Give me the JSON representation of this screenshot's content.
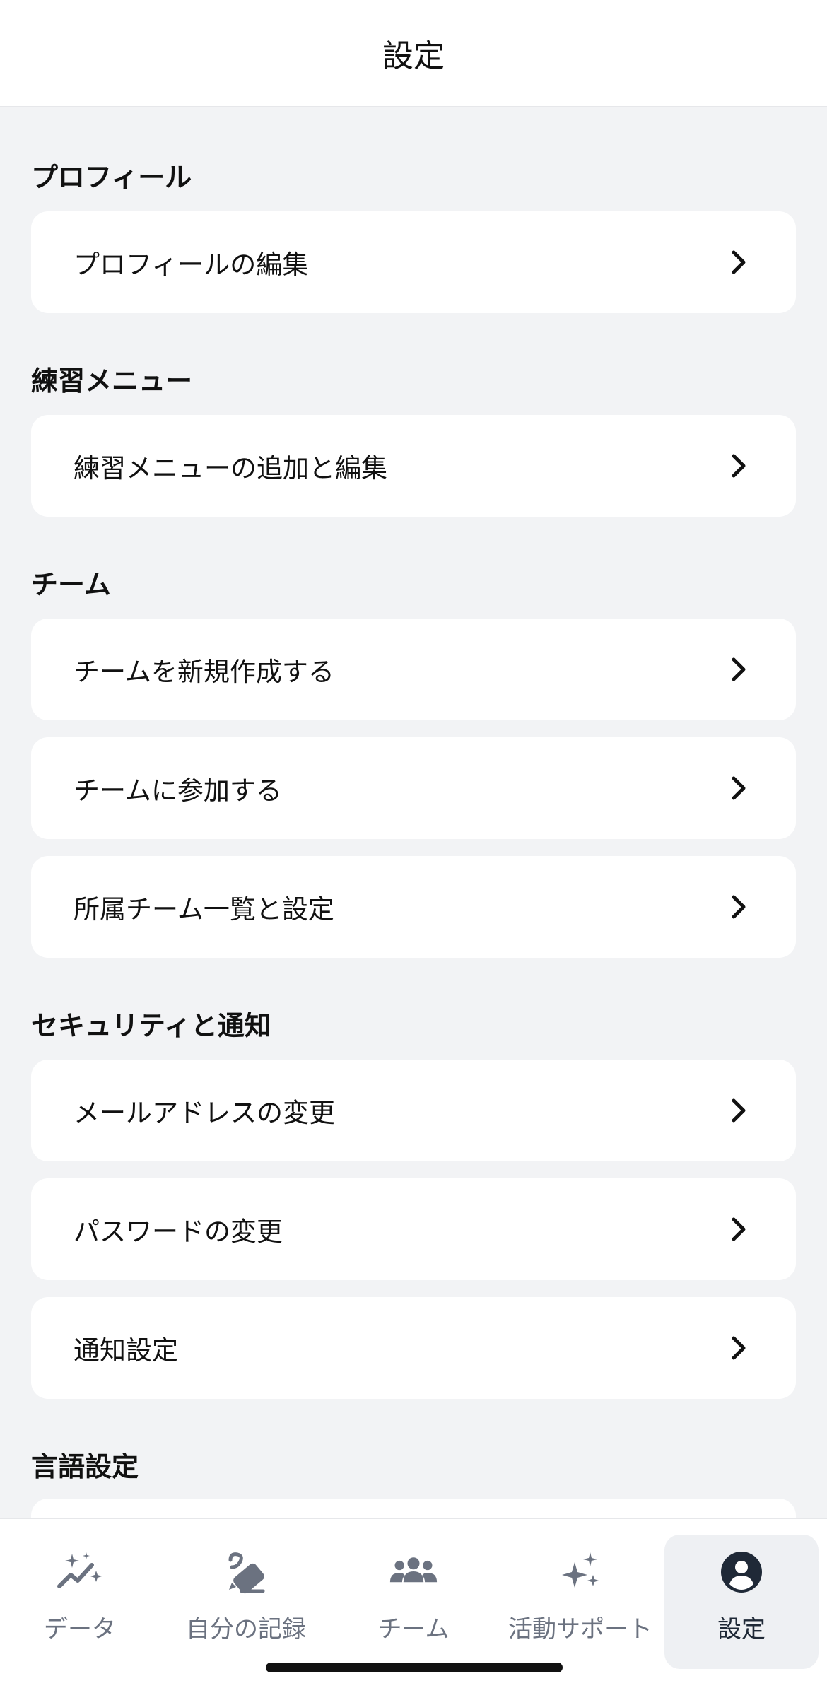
{
  "header": {
    "title": "設定"
  },
  "sections": {
    "profile": {
      "title": "プロフィール",
      "items": [
        {
          "label": "プロフィールの編集"
        }
      ]
    },
    "practice": {
      "title": "練習メニュー",
      "items": [
        {
          "label": "練習メニューの追加と編集"
        }
      ]
    },
    "team": {
      "title": "チーム",
      "items": [
        {
          "label": "チームを新規作成する"
        },
        {
          "label": "チームに参加する"
        },
        {
          "label": "所属チーム一覧と設定"
        }
      ]
    },
    "security": {
      "title": "セキュリティと通知",
      "items": [
        {
          "label": "メールアドレスの変更"
        },
        {
          "label": "パスワードの変更"
        },
        {
          "label": "通知設定"
        }
      ]
    },
    "language": {
      "title": "言語設定"
    }
  },
  "tabbar": {
    "items": [
      {
        "label": "データ",
        "icon": "sparkle-chart-icon"
      },
      {
        "label": "自分の記録",
        "icon": "pencil-note-icon"
      },
      {
        "label": "チーム",
        "icon": "people-group-icon"
      },
      {
        "label": "活動サポート",
        "icon": "sparkles-icon"
      },
      {
        "label": "設定",
        "icon": "user-circle-icon",
        "active": true
      }
    ]
  },
  "colors": {
    "background": "#f2f3f5",
    "card": "#ffffff",
    "tab_inactive": "#6b7280",
    "tab_active": "#1f2937"
  }
}
